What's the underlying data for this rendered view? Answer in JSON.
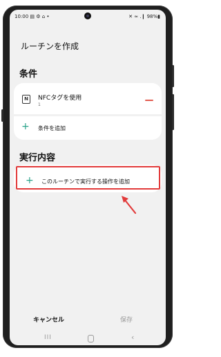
{
  "status_bar": {
    "time": "10:00",
    "left_icons": "▤ ⚙ ⌂ •",
    "right_icons": "✕ ≈ .❙ 98%▮"
  },
  "header": {
    "title": "ルーチンを作成"
  },
  "conditions": {
    "section_title": "条件",
    "item": {
      "label": "NFCタグを使用",
      "sub": "1",
      "icon": "nfc-icon"
    },
    "add_label": "条件を追加"
  },
  "actions": {
    "section_title": "実行内容",
    "add_label": "このルーチンで実行する操作を追加"
  },
  "footer": {
    "cancel": "キャンセル",
    "save": "保存"
  },
  "navbar": {
    "recents": "III",
    "back": "‹"
  },
  "colors": {
    "accent_plus": "#2aa38a",
    "remove": "#e25a4e",
    "highlight": "#e23a3a"
  }
}
